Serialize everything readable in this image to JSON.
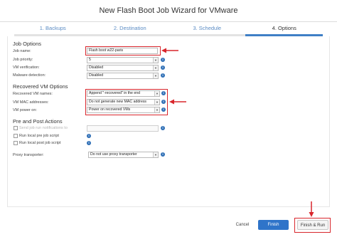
{
  "window": {
    "title": "New Flash Boot Job Wizard for VMware"
  },
  "steps": [
    "1. Backups",
    "2. Destination",
    "3. Schedule",
    "4. Options"
  ],
  "job_options": {
    "heading": "Job Options",
    "job_name_label": "Job name:",
    "job_name_value": "Flash boot w22-paris",
    "job_priority_label": "Job priority:",
    "job_priority_value": "5",
    "vm_verification_label": "VM verification:",
    "vm_verification_value": "Disabled",
    "malware_detection_label": "Malware detection:",
    "malware_detection_value": "Disabled"
  },
  "recovered_vm_options": {
    "heading": "Recovered VM Options",
    "vm_names_label": "Recovered VM names:",
    "vm_names_value": "Append \"-recovered\" in the end",
    "mac_label": "VM MAC addresses:",
    "mac_value": "Do not generate new MAC address",
    "power_label": "VM power on:",
    "power_value": "Power on recovered VMs"
  },
  "pre_post": {
    "heading": "Pre and Post Actions",
    "send_notifications": "Send job run notifications to",
    "run_local_pre": "Run local pre job script",
    "run_local_post": "Run local post job script"
  },
  "proxy": {
    "label": "Proxy transporter:",
    "value": "Do not use proxy transporter"
  },
  "buttons": {
    "cancel": "Cancel",
    "finish": "Finish",
    "finish_run": "Finish & Run"
  },
  "colors": {
    "accent": "#2f74c9",
    "highlight": "#d8262c",
    "step_link": "#5b8cc4"
  },
  "icons": {
    "info": "info-icon",
    "dropdown": "chevron-down-icon",
    "arrow": "red-arrow-annotation"
  }
}
